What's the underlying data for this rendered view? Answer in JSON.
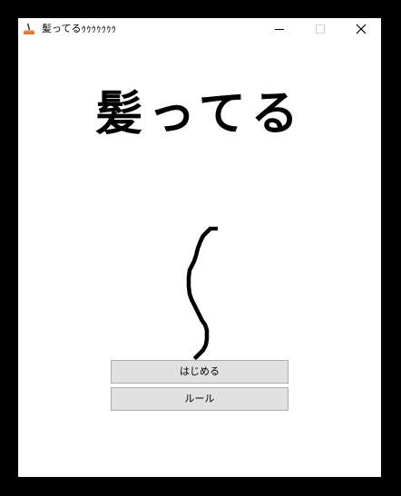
{
  "window": {
    "title": "髪ってるｩｩｩｩｩｩｩ"
  },
  "main": {
    "app_title": "髪ってる",
    "start_label": "はじめる",
    "rules_label": "ルール"
  },
  "icons": {
    "app": "app-icon",
    "minimize": "minimize-icon",
    "maximize": "maximize-icon",
    "close": "close-icon",
    "hair": "hair-strand-image"
  },
  "colors": {
    "background": "#ffffff",
    "button_face": "#e1e1e1",
    "button_border": "#adadad",
    "text": "#000000",
    "hair": "#000000"
  }
}
